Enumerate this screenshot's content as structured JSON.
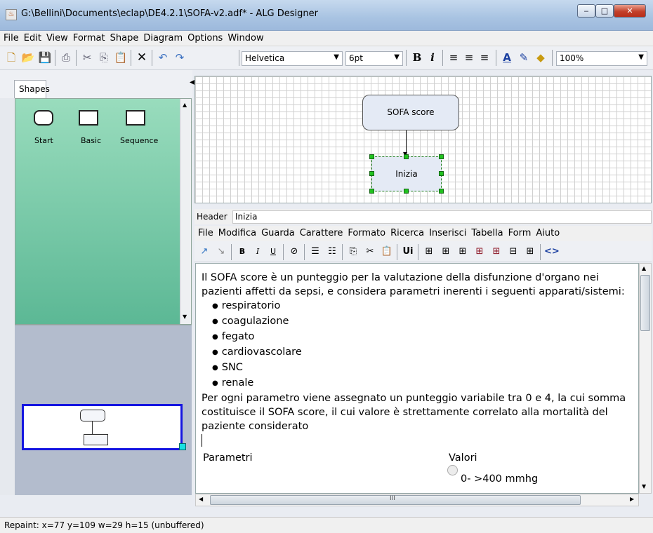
{
  "window": {
    "title": "G:\\Bellini\\Documents\\eclap\\DE4.2.1\\SOFA-v2.adf* - ALG Designer",
    "minimize": "‒",
    "maximize": "□",
    "close": "✕"
  },
  "menu": [
    "File",
    "Edit",
    "View",
    "Format",
    "Shape",
    "Diagram",
    "Options",
    "Window"
  ],
  "toolbar": {
    "font": "Helvetica",
    "size": "6pt",
    "bold": "B",
    "italic": "i",
    "zoom": "100%"
  },
  "palette": {
    "tab": "Shapes",
    "items": [
      "Start",
      "Basic",
      "Sequence"
    ]
  },
  "canvas": {
    "node1": "SOFA score",
    "node2": "Inizia"
  },
  "header": {
    "label": "Header",
    "value": "Inizia"
  },
  "editor_menu": [
    "File",
    "Modifica",
    "Guarda",
    "Carattere",
    "Formato",
    "Ricerca",
    "Inserisci",
    "Tabella",
    "Form",
    "Aiuto"
  ],
  "editor": {
    "intro": "Il SOFA score è un punteggio per la valutazione della disfunzione d'organo nei pazienti affetti da sepsi, e considera parametri inerenti i seguenti apparati/sistemi:",
    "items": [
      "respiratorio",
      "coagulazione",
      "fegato",
      "cardiovascolare",
      "SNC",
      "renale"
    ],
    "outro": "Per ogni parametro viene assegnato un punteggio variabile tra 0 e 4, la cui somma costituisce il SOFA score, il cui valore è strettamente correlato alla mortalità del paziente considerato",
    "col_params": "Parametri",
    "col_values": "Valori",
    "radio_label": "0- >400 mmhg"
  },
  "hscroll": {
    "grip": "III"
  },
  "status": "Repaint: x=77 y=109 w=29 h=15 (unbuffered)"
}
